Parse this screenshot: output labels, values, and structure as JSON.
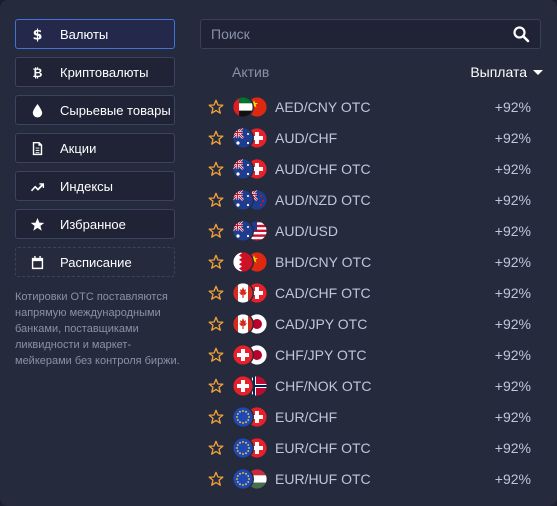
{
  "categories": [
    {
      "label": "Валюты",
      "icon": "dollar-icon",
      "active": true
    },
    {
      "label": "Криптовалюты",
      "icon": "bitcoin-icon"
    },
    {
      "label": "Сырьевые товары",
      "icon": "drop-icon"
    },
    {
      "label": "Акции",
      "icon": "document-icon"
    },
    {
      "label": "Индексы",
      "icon": "trend-icon"
    },
    {
      "label": "Избранное",
      "icon": "star-icon"
    },
    {
      "label": "Расписание",
      "icon": "calendar-icon",
      "dashed": true
    }
  ],
  "note": "Котировки OTC поставляются напрямую международными банками, поставщиками ликвидности и маркет-мейкерами без контроля биржи.",
  "search": {
    "placeholder": "Поиск"
  },
  "header": {
    "asset": "Актив",
    "payout": "Выплата"
  },
  "assets": [
    {
      "name": "AED/CNY OTC",
      "payout": "+92%",
      "flags": [
        "ae",
        "cn"
      ]
    },
    {
      "name": "AUD/CHF",
      "payout": "+92%",
      "flags": [
        "au",
        "ch"
      ]
    },
    {
      "name": "AUD/CHF OTC",
      "payout": "+92%",
      "flags": [
        "au",
        "ch"
      ]
    },
    {
      "name": "AUD/NZD OTC",
      "payout": "+92%",
      "flags": [
        "au",
        "nz"
      ]
    },
    {
      "name": "AUD/USD",
      "payout": "+92%",
      "flags": [
        "au",
        "us"
      ]
    },
    {
      "name": "BHD/CNY OTC",
      "payout": "+92%",
      "flags": [
        "bh",
        "cn"
      ]
    },
    {
      "name": "CAD/CHF OTC",
      "payout": "+92%",
      "flags": [
        "ca",
        "ch"
      ]
    },
    {
      "name": "CAD/JPY OTC",
      "payout": "+92%",
      "flags": [
        "ca",
        "jp"
      ]
    },
    {
      "name": "CHF/JPY OTC",
      "payout": "+92%",
      "flags": [
        "ch",
        "jp"
      ]
    },
    {
      "name": "CHF/NOK OTC",
      "payout": "+92%",
      "flags": [
        "ch",
        "no"
      ]
    },
    {
      "name": "EUR/CHF",
      "payout": "+92%",
      "flags": [
        "eu",
        "ch"
      ]
    },
    {
      "name": "EUR/CHF OTC",
      "payout": "+92%",
      "flags": [
        "eu",
        "ch"
      ]
    },
    {
      "name": "EUR/HUF OTC",
      "payout": "+92%",
      "flags": [
        "eu",
        "hu"
      ]
    }
  ],
  "colors": {
    "accent": "#3f74d6",
    "star": "#f0a23a",
    "panel": "#252a3d"
  }
}
